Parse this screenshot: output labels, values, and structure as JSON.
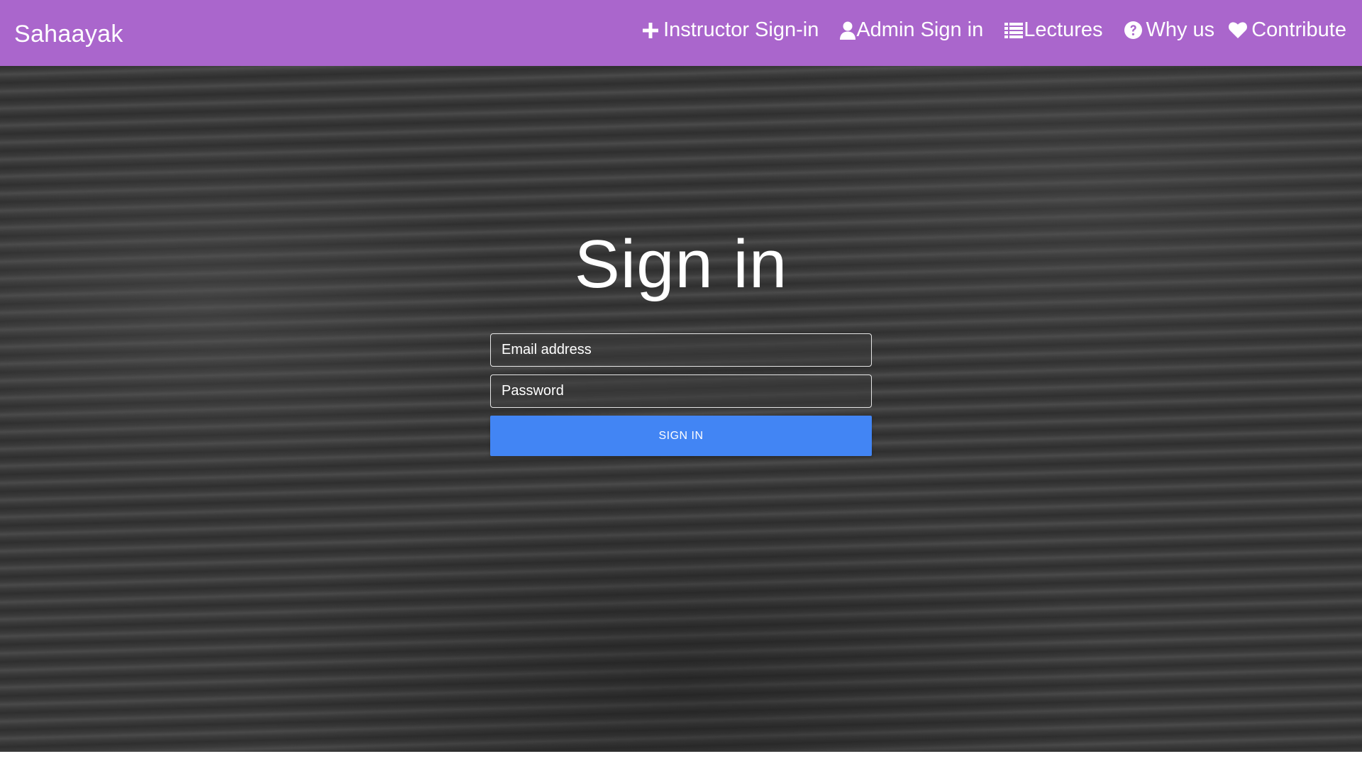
{
  "navbar": {
    "brand": "Sahaayak",
    "background_color": "#aa66cc",
    "items": [
      {
        "label": "Instructor Sign-in",
        "icon": "plus-icon"
      },
      {
        "label": "Admin Sign in",
        "icon": "user-icon"
      },
      {
        "label": "Lectures",
        "icon": "list-icon"
      },
      {
        "label": "Why us",
        "icon": "question-circle-icon"
      },
      {
        "label": "Contribute",
        "icon": "heart-icon"
      }
    ]
  },
  "signin": {
    "title": "Sign in",
    "email_placeholder": "Email address",
    "email_value": "",
    "password_placeholder": "Password",
    "password_value": "",
    "button_label": "SIGN IN",
    "button_color": "#4285f4"
  },
  "background": {
    "description_color": "#3c3c3c"
  }
}
